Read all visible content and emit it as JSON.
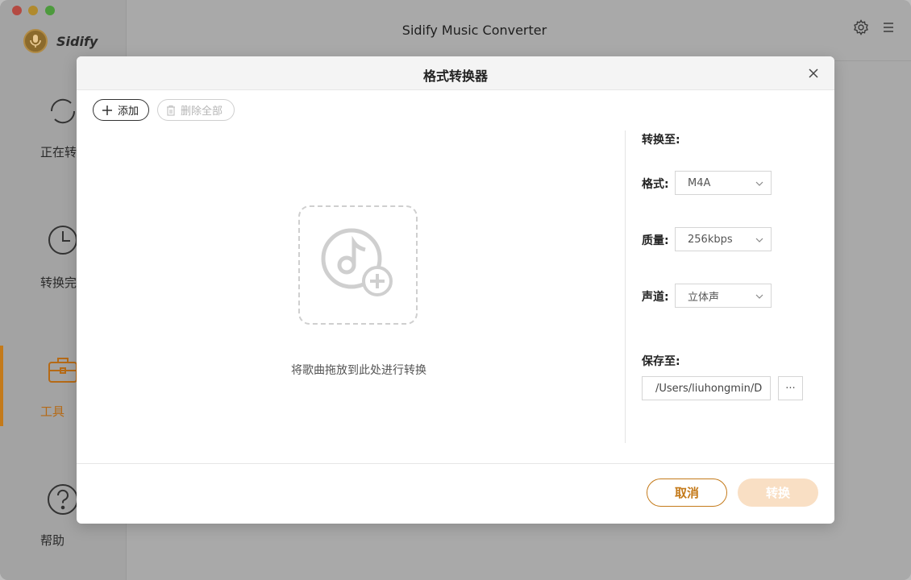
{
  "window": {
    "title": "Sidify Music Converter",
    "logo_text": "Sidify"
  },
  "sidebar": {
    "items": [
      {
        "label": "正在转",
        "icon": "refresh-icon"
      },
      {
        "label": "转换完",
        "icon": "clock-icon"
      },
      {
        "label": "工具",
        "icon": "toolbox-icon",
        "active": true
      },
      {
        "label": "帮助",
        "icon": "help-icon"
      }
    ]
  },
  "dialog": {
    "title": "格式转换器",
    "add_label": "添加",
    "delete_all_label": "删除全部",
    "drop_text": "将歌曲拖放到此处进行转换",
    "convert_to_label": "转换至:",
    "format_label": "格式:",
    "format_value": "M4A",
    "quality_label": "质量:",
    "quality_value": "256kbps",
    "channel_label": "声道:",
    "channel_value": "立体声",
    "save_to_label": "保存至:",
    "save_path": "/Users/liuhongmin/D",
    "browse_label": "···",
    "cancel_label": "取消",
    "convert_label": "转换"
  },
  "colors": {
    "accent": "#c47a1a",
    "convert_disabled": "#f9dfc4"
  }
}
